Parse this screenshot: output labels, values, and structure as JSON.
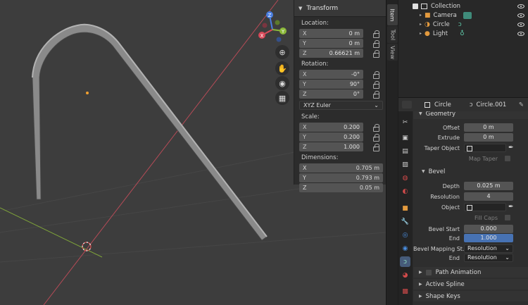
{
  "transform_panel": {
    "title": "Transform",
    "location_label": "Location:",
    "location": [
      {
        "axis": "X",
        "value": "0 m"
      },
      {
        "axis": "Y",
        "value": "0 m"
      },
      {
        "axis": "Z",
        "value": "0.66621 m"
      }
    ],
    "rotation_label": "Rotation:",
    "rotation": [
      {
        "axis": "X",
        "value": "-0°"
      },
      {
        "axis": "Y",
        "value": "90°"
      },
      {
        "axis": "Z",
        "value": "0°"
      }
    ],
    "rotation_mode": "XYZ Euler",
    "scale_label": "Scale:",
    "scale": [
      {
        "axis": "X",
        "value": "0.200"
      },
      {
        "axis": "Y",
        "value": "0.200"
      },
      {
        "axis": "Z",
        "value": "1.000"
      }
    ],
    "dimensions_label": "Dimensions:",
    "dimensions": [
      {
        "axis": "X",
        "value": "0.705 m"
      },
      {
        "axis": "Y",
        "value": "0.793 m"
      },
      {
        "axis": "Z",
        "value": "0.05 m"
      }
    ]
  },
  "gizmo": {
    "x": "X",
    "y": "Y",
    "z": "Z"
  },
  "side_tabs": [
    "Item",
    "Tool",
    "View"
  ],
  "outliner": {
    "items": [
      {
        "name": "Collection",
        "icon": "collection-icon"
      },
      {
        "name": "Camera",
        "icon": "camera-icon"
      },
      {
        "name": "Circle",
        "icon": "curve-icon"
      },
      {
        "name": "Light",
        "icon": "light-icon"
      }
    ]
  },
  "properties": {
    "object_name": "Circle",
    "data_name": "Circle.001",
    "geometry": {
      "title": "Geometry",
      "offset_label": "Offset",
      "offset": "0 m",
      "extrude_label": "Extrude",
      "extrude": "0 m",
      "taper_label": "Taper Object",
      "map_taper_label": "Map Taper"
    },
    "bevel": {
      "title": "Bevel",
      "depth_label": "Depth",
      "depth": "0.025 m",
      "resolution_label": "Resolution",
      "resolution": "4",
      "object_label": "Object",
      "fill_caps_label": "Fill Caps",
      "bevel_start_label": "Bevel Start",
      "bevel_start": "0.000",
      "end_label": "End",
      "end": "1.000",
      "mapping_start_label": "Bevel Mapping St...",
      "mapping_start": "Resolution",
      "mapping_end_label": "End",
      "mapping_end": "Resolution"
    },
    "sections": [
      "Path Animation",
      "Active Spline",
      "Shape Keys"
    ]
  },
  "colors": {
    "viewport_bg": "#3d3d3d",
    "x_axis": "#d94a5a",
    "y_axis": "#8bb83a",
    "z_axis": "#4a7ee0",
    "active_field": "#4772b3"
  }
}
